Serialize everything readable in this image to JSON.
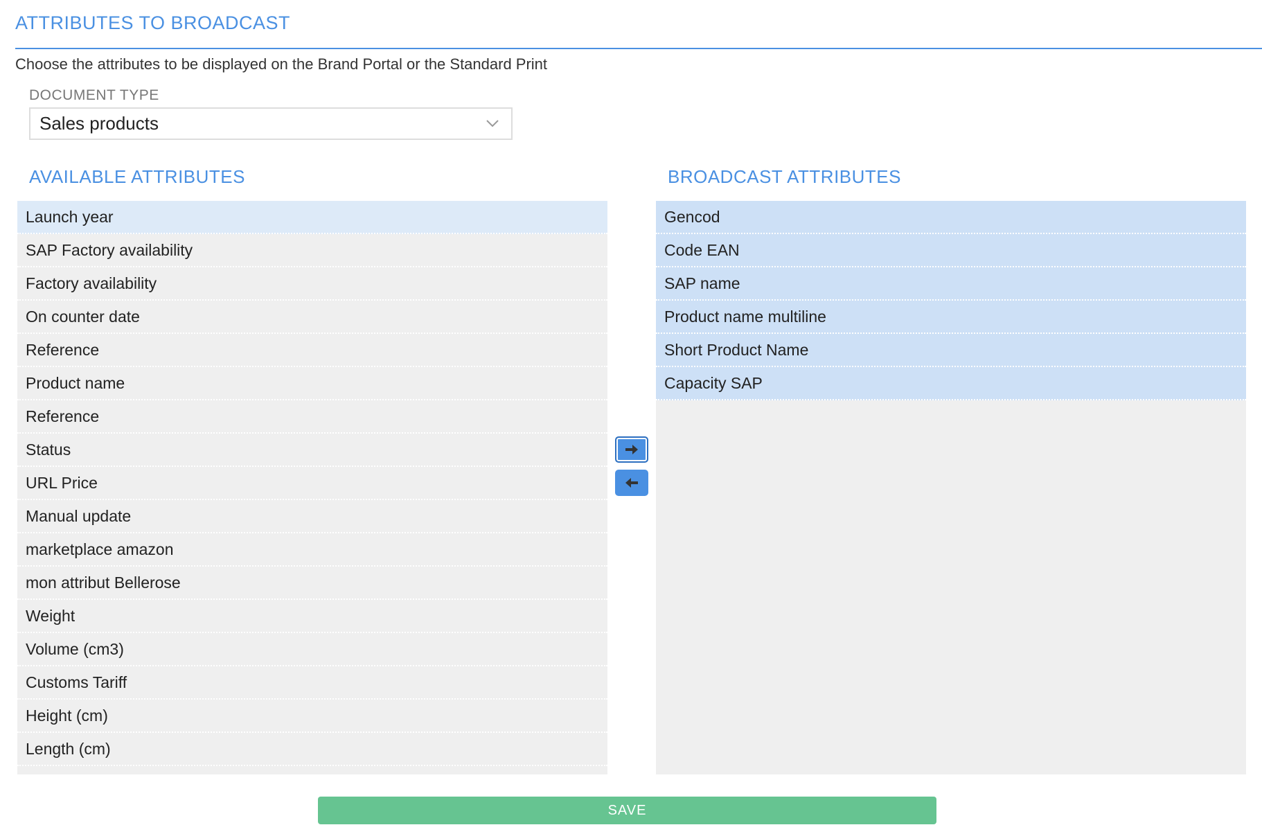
{
  "header": {
    "title": "ATTRIBUTES TO BROADCAST",
    "subtitle": "Choose the attributes to be displayed on the Brand Portal or the Standard Print"
  },
  "document_type": {
    "label": "DOCUMENT TYPE",
    "selected": "Sales products"
  },
  "available": {
    "title": "AVAILABLE ATTRIBUTES",
    "items": [
      "Launch year",
      "SAP Factory availability",
      "Factory availability",
      "On counter date",
      "Reference",
      "Product name",
      "Reference",
      "Status",
      "URL Price",
      "Manual update",
      "marketplace amazon",
      "mon attribut Bellerose",
      "Weight",
      "Volume (cm3)",
      "Customs Tariff",
      "Height (cm)",
      "Length (cm)"
    ]
  },
  "broadcast": {
    "title": "BROADCAST ATTRIBUTES",
    "items": [
      "Gencod",
      "Code EAN",
      "SAP name",
      "Product name multiline",
      "Short Product Name",
      "Capacity SAP"
    ]
  },
  "actions": {
    "add_icon": "arrow-right-icon",
    "remove_icon": "arrow-left-icon",
    "save_label": "SAVE"
  },
  "colors": {
    "accent": "#4a90e2",
    "save": "#66c491",
    "selected_row": "#cde0f6",
    "list_bg": "#efefef"
  }
}
